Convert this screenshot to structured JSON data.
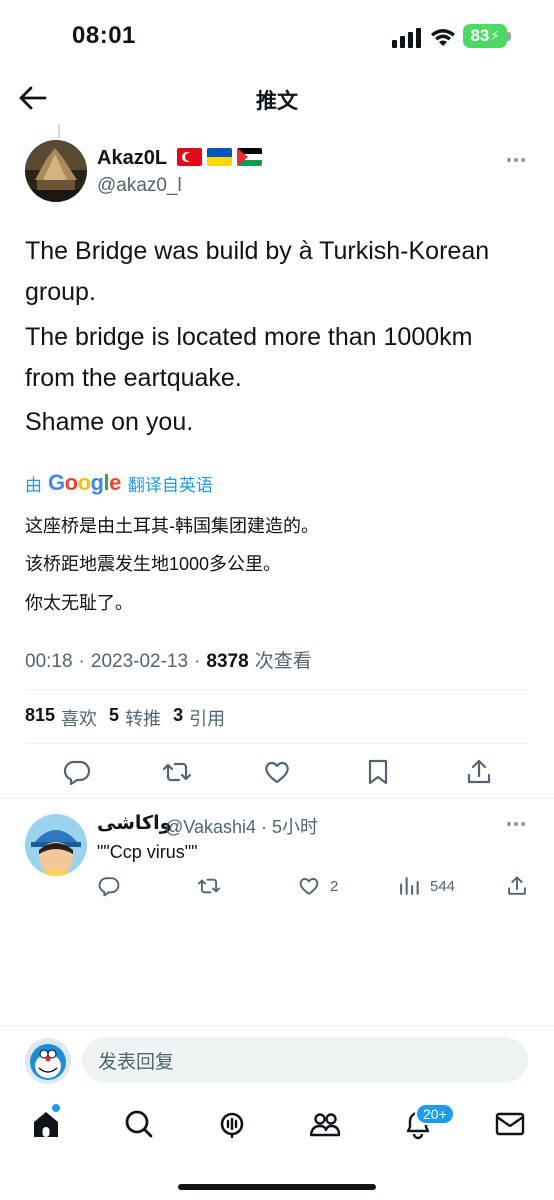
{
  "status_bar": {
    "time": "08:01",
    "battery": "83"
  },
  "header": {
    "title": "推文"
  },
  "tweet": {
    "author_name": "Akaz0L",
    "author_handle": "@akaz0_l",
    "text_paragraphs": [
      "The Bridge was build by à Turkish-Korean group.",
      "The bridge is located more than 1000km from the eartquake.",
      "Shame on you."
    ],
    "translation": {
      "prefix": "由",
      "provider": "Google",
      "suffix": "翻译自英语",
      "lines": [
        "这座桥是由土耳其-韩国集团建造的。",
        "该桥距地震发生地1000多公里。",
        "你太无耻了。"
      ]
    },
    "meta": {
      "time": "00:18",
      "date": "2023-02-13",
      "views": "8378",
      "views_label": "次查看"
    },
    "stats": {
      "likes": "815",
      "likes_label": "喜欢",
      "retweets": "5",
      "retweets_label": "转推",
      "quotes": "3",
      "quotes_label": "引用"
    }
  },
  "reply": {
    "name": "واكاشى",
    "handle": "@Vakashi4",
    "time": "· 5小时",
    "text": "\"\"Ccp virus\"\"",
    "likes": "2",
    "views": "544"
  },
  "compose": {
    "placeholder": "发表回复"
  },
  "tab_bar": {
    "notifications_badge": "20+"
  },
  "colors": {
    "accent": "#1d9bf0",
    "text": "#0f1419",
    "secondary": "#536471",
    "battery": "#4cd964"
  }
}
